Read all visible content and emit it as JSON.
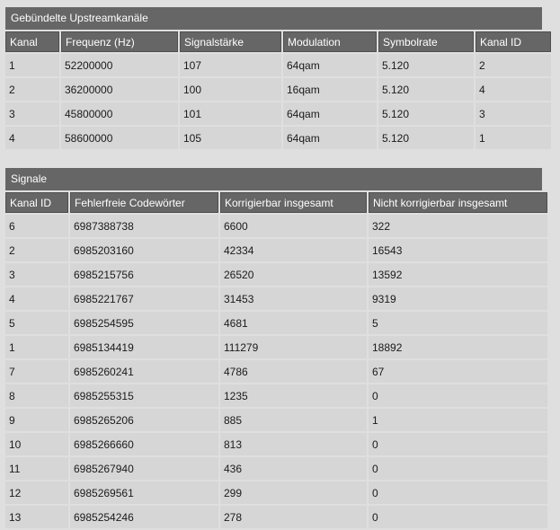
{
  "upstream": {
    "title": "Gebündelte Upstreamkanäle",
    "columns": [
      "Kanal",
      "Frequenz (Hz)",
      "Signalstärke",
      "Modulation",
      "Symbolrate",
      "Kanal ID"
    ],
    "rows": [
      [
        "1",
        "52200000",
        "107",
        "64qam",
        "5.120",
        "2"
      ],
      [
        "2",
        "36200000",
        "100",
        "16qam",
        "5.120",
        "4"
      ],
      [
        "3",
        "45800000",
        "101",
        "64qam",
        "5.120",
        "3"
      ],
      [
        "4",
        "58600000",
        "105",
        "64qam",
        "5.120",
        "1"
      ]
    ]
  },
  "signals": {
    "title": "Signale",
    "columns": [
      "Kanal ID",
      "Fehlerfreie Codewörter",
      "Korrigierbar insgesamt",
      "Nicht korrigierbar insgesamt"
    ],
    "rows": [
      [
        "6",
        "6987388738",
        "6600",
        "322"
      ],
      [
        "2",
        "6985203160",
        "42334",
        "16543"
      ],
      [
        "3",
        "6985215756",
        "26520",
        "13592"
      ],
      [
        "4",
        "6985221767",
        "31453",
        "9319"
      ],
      [
        "5",
        "6985254595",
        "4681",
        "5"
      ],
      [
        "1",
        "6985134419",
        "111279",
        "18892"
      ],
      [
        "7",
        "6985260241",
        "4786",
        "67"
      ],
      [
        "8",
        "6985255315",
        "1235",
        "0"
      ],
      [
        "9",
        "6985265206",
        "885",
        "1"
      ],
      [
        "10",
        "6985266660",
        "813",
        "0"
      ],
      [
        "11",
        "6985267940",
        "436",
        "0"
      ],
      [
        "12",
        "6985269561",
        "299",
        "0"
      ],
      [
        "13",
        "6985254246",
        "278",
        "0"
      ]
    ]
  }
}
